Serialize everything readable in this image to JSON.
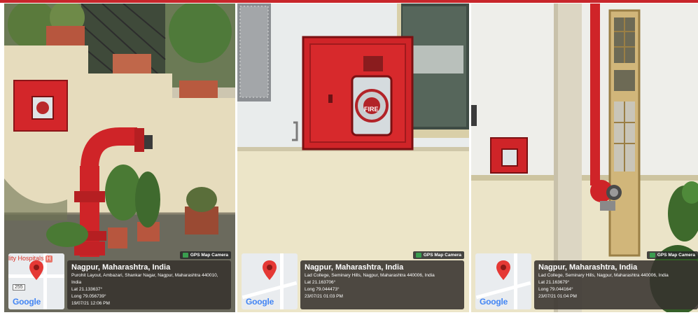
{
  "photos": [
    {
      "gps_badge": "GPS Map Camera",
      "city": "Nagpur, Maharashtra, India",
      "address_line1": "Purohit Layout, Ambazari, Shankar Nagar, Nagpur, Maharashtra 440010,",
      "address_line2": "India",
      "lat": "Lat 21.133637°",
      "long": "Long 79.056739°",
      "datetime": "19/07/21 12:06 PM",
      "map_label": "lity Hospitals",
      "map_road_badge": "255",
      "map_brand": "Google"
    },
    {
      "gps_badge": "GPS Map Camera",
      "city": "Nagpur, Maharashtra, India",
      "address_line1": "Lad College, Seminary Hills, Nagpur, Maharashtra 440006, India",
      "lat": "Lat 21.163706°",
      "long": "Long 79.044473°",
      "datetime": "23/07/21 01:03 PM",
      "cabinet_text": "FIRE",
      "map_brand": "Google"
    },
    {
      "gps_badge": "GPS Map Camera",
      "city": "Nagpur, Maharashtra, India",
      "address_line1": "Lad College, Seminary Hills, Nagpur, Maharashtra 440006, India",
      "lat": "Lat 21.163679°",
      "long": "Long 79.044164°",
      "datetime": "23/07/21 01:04 PM",
      "map_brand": "Google"
    }
  ],
  "colors": {
    "accent_bar": "#c8262b",
    "fire_red": "#d3262a",
    "overlay_bg": "#37322d"
  }
}
